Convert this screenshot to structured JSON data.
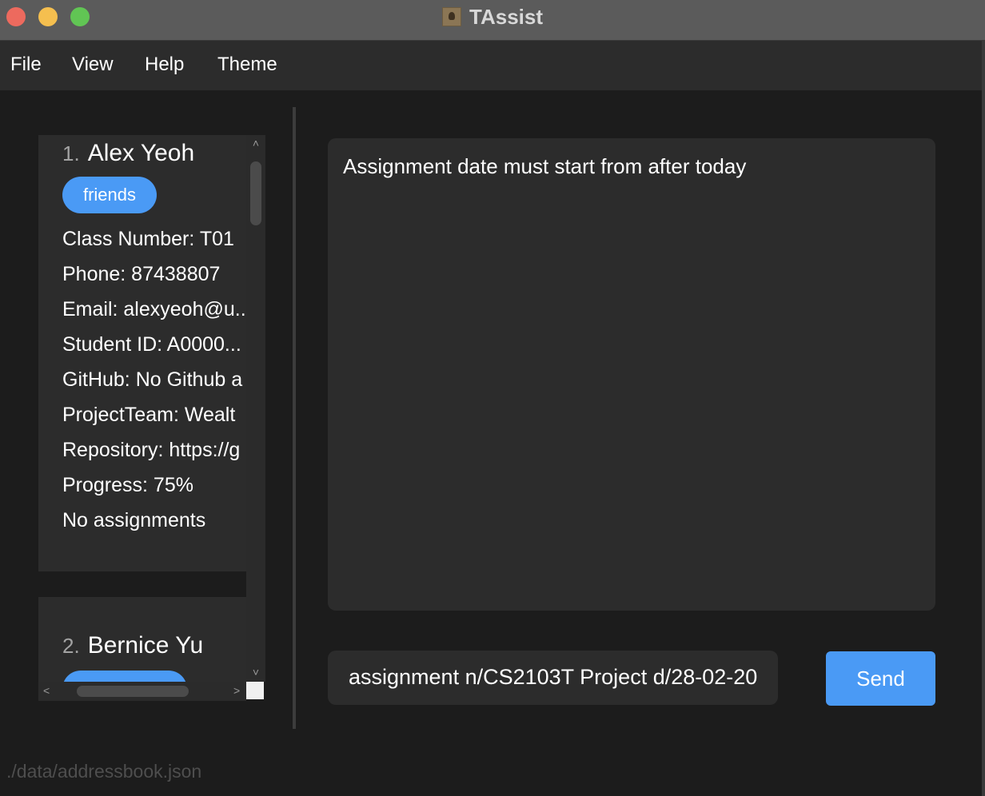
{
  "window": {
    "title": "TAssist",
    "icon": "contacts-app-icon"
  },
  "menu": [
    "File",
    "View",
    "Help",
    "Theme"
  ],
  "persons": [
    {
      "index": "1.",
      "name": "Alex Yeoh",
      "tag": "friends",
      "fields": [
        "Class Number: T01",
        "Phone: 87438807",
        "Email: alexyeoh@u...",
        "Student ID: A0000...",
        "GitHub: No Github a",
        "ProjectTeam: Wealt",
        "Repository: https://g",
        "Progress: 75%",
        "No assignments"
      ]
    },
    {
      "index": "2.",
      "name": "Bernice Yu"
    }
  ],
  "result": {
    "message": "Assignment date must start from after today"
  },
  "command": {
    "value": "assignment n/CS2103T Project d/28-02-20"
  },
  "send_label": "Send",
  "status": {
    "path": "./data/addressbook.json"
  },
  "colors": {
    "accent": "#4a9af5",
    "background": "#1c1c1c",
    "panel": "#2c2c2c"
  },
  "scrollbars": {
    "arrow_up": "˄",
    "arrow_down": "˅",
    "arrow_left": "<",
    "arrow_right": ">"
  }
}
